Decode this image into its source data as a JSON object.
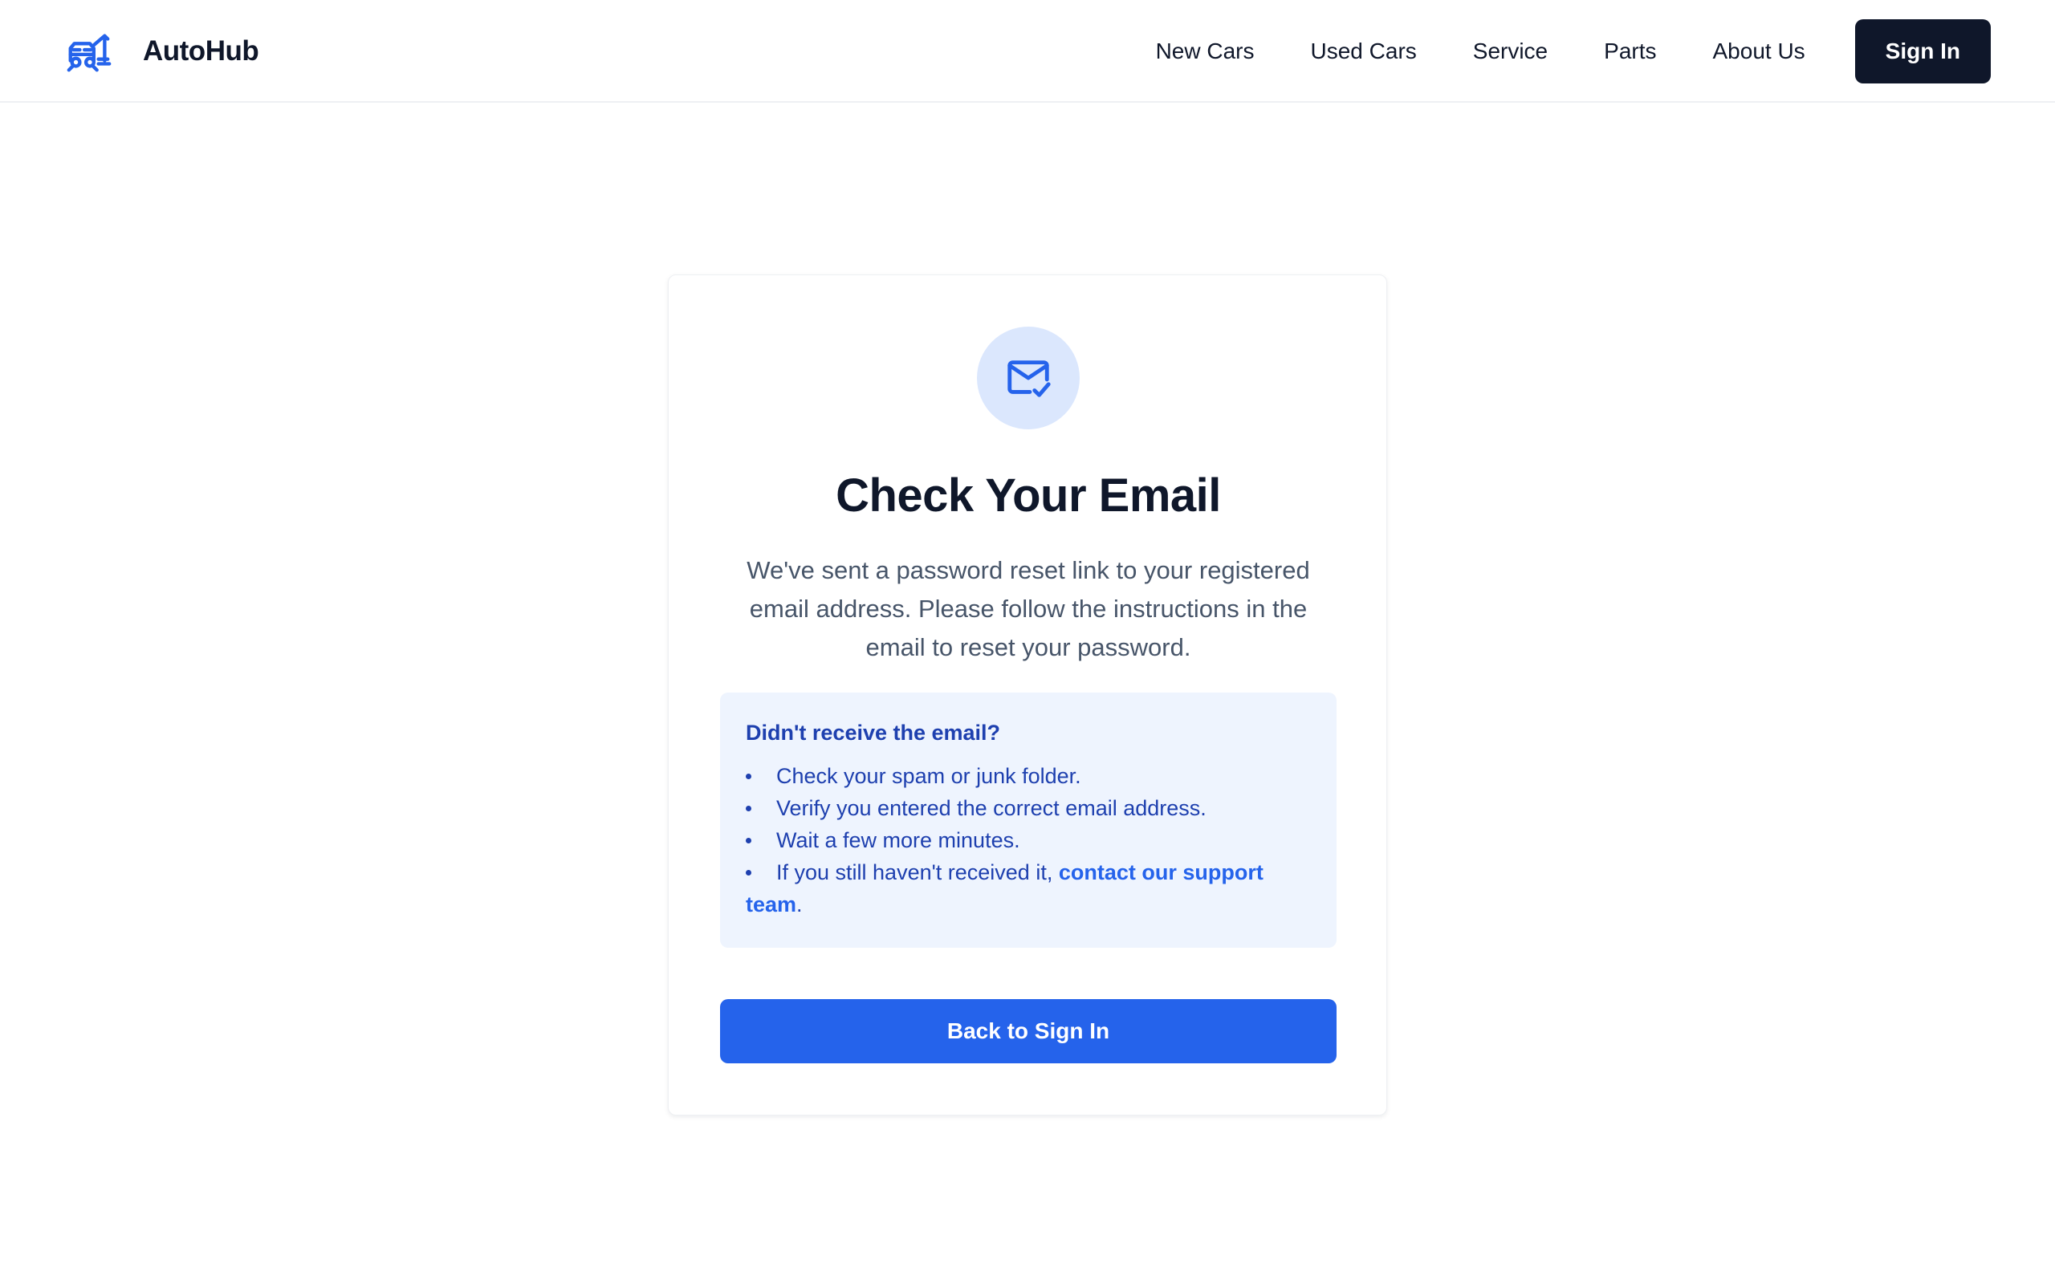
{
  "brand": {
    "name": "AutoHub",
    "icon": "car-hub-icon"
  },
  "nav": {
    "links": [
      "New Cars",
      "Used Cars",
      "Service",
      "Parts",
      "About Us"
    ],
    "sign_in_label": "Sign In"
  },
  "card": {
    "icon": "mail-check-icon",
    "title": "Check Your Email",
    "description": "We've sent a password reset link to your registered email address. Please follow the instructions in the email to reset your password.",
    "help": {
      "title": "Didn't receive the email?",
      "tips": [
        "Check your spam or junk folder.",
        "Verify you entered the correct email address.",
        "Wait a few more minutes."
      ],
      "last_tip_prefix": "If you still haven't received it, ",
      "support_link_label": "contact our support team",
      "last_tip_suffix": "."
    },
    "back_button_label": "Back to Sign In"
  },
  "colors": {
    "primary": "#2563eb",
    "dark": "#0f172a",
    "info_bg": "#eef4fe",
    "info_text": "#1e40af",
    "icon_bg": "#dbe7fd"
  }
}
